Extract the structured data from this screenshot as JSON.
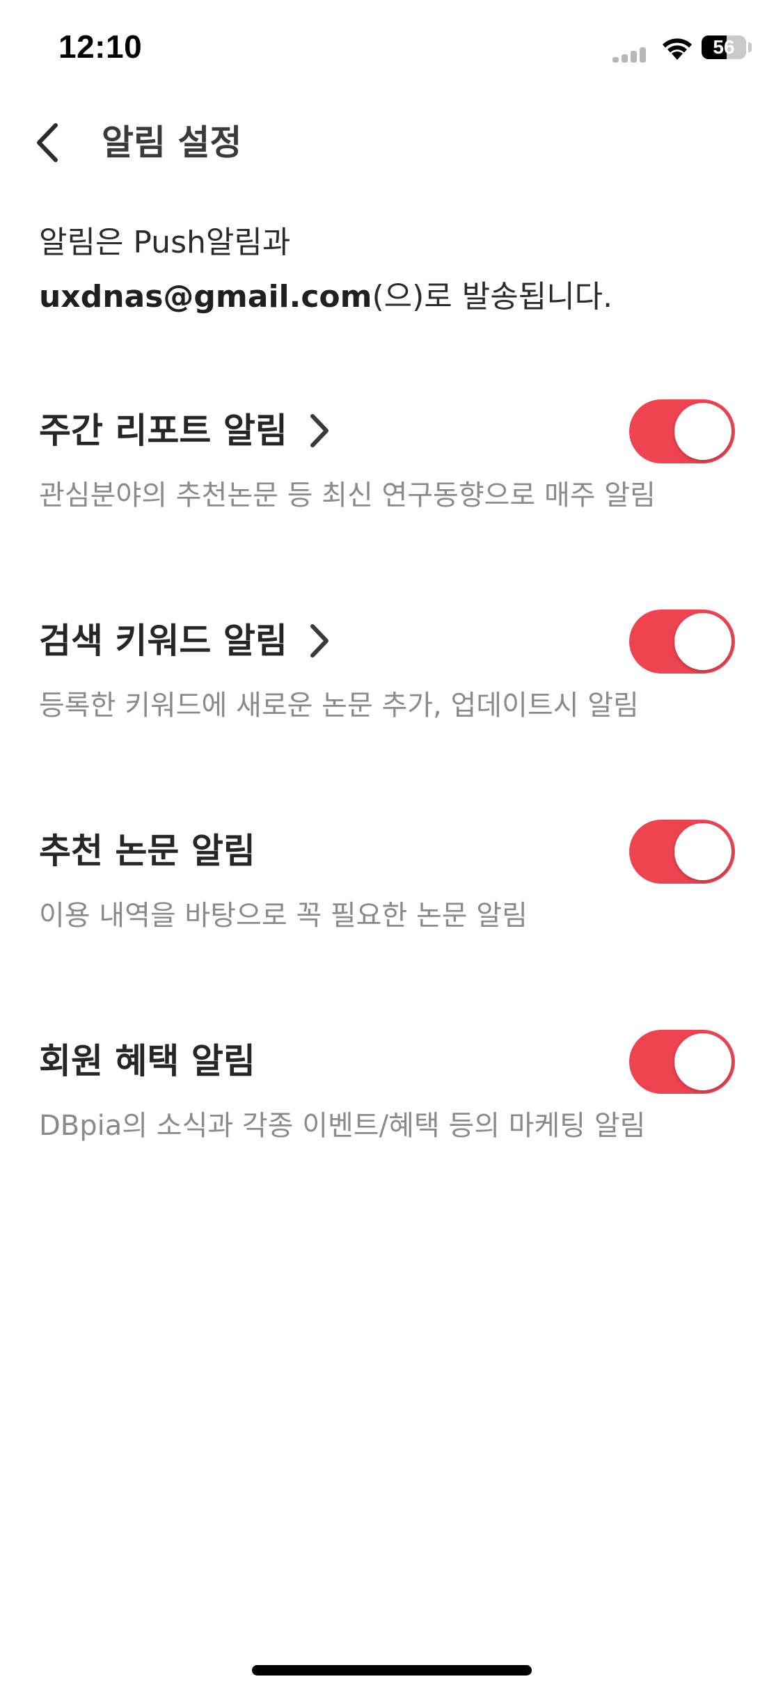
{
  "status_bar": {
    "time": "12:10",
    "battery_level": "56"
  },
  "header": {
    "title": "알림 설정",
    "back_icon": "chevron-left-icon"
  },
  "intro": {
    "line1": "알림은 Push알림과",
    "email": "uxdnas@gmail.com",
    "line2_suffix": "(으)로 발송됩니다."
  },
  "settings": [
    {
      "title": "주간 리포트 알림",
      "has_link": true,
      "description": "관심분야의 추천논문 등 최신 연구동향으로 매주 알림",
      "enabled": true
    },
    {
      "title": "검색 키워드 알림",
      "has_link": true,
      "description": "등록한 키워드에 새로운 논문 추가, 업데이트시 알림",
      "enabled": true
    },
    {
      "title": "추천 논문 알림",
      "has_link": false,
      "description": "이용 내역을 바탕으로 꼭 필요한 논문 알림",
      "enabled": true
    },
    {
      "title": "회원 혜택 알림",
      "has_link": false,
      "description": "DBpia의 소식과 각종 이벤트/혜택 등의 마케팅 알림",
      "enabled": true
    }
  ],
  "colors": {
    "toggle_on": "#ee4452",
    "description_text": "#8a8a8a"
  }
}
